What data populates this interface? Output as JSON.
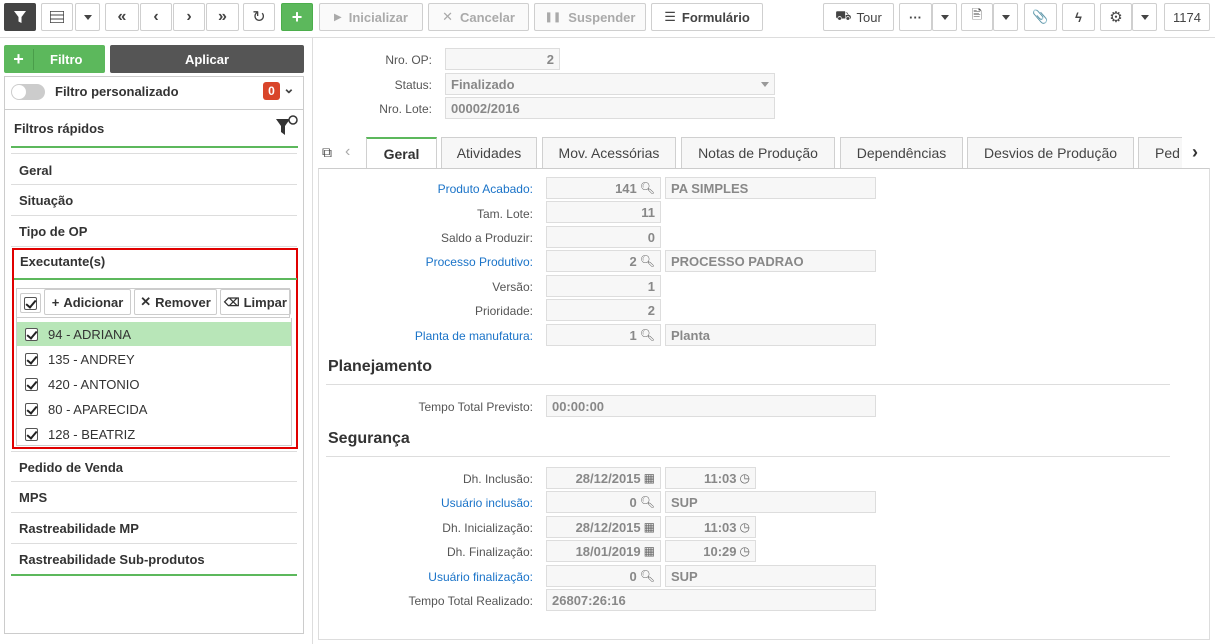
{
  "toolbar": {
    "inicializar": "Inicializar",
    "cancelar": "Cancelar",
    "suspender": "Suspender",
    "formulario": "Formulário",
    "tour": "Tour",
    "counter": "1174"
  },
  "filters": {
    "add_filter": "Filtro",
    "apply": "Aplicar",
    "custom_filter_label": "Filtro personalizado",
    "custom_filter_count": "0",
    "quick_filters_title": "Filtros rápidos",
    "sections_top": [
      "Geral",
      "Situação",
      "Tipo de OP",
      "Executante(s)"
    ],
    "executantes": {
      "add_label": "Adicionar",
      "remove_label": "Remover",
      "clear_label": "Limpar",
      "items": [
        "94 - ADRIANA",
        "135 - ANDREY",
        "420 - ANTONIO",
        "80 - APARECIDA",
        "128 - BEATRIZ"
      ]
    },
    "sections_bottom": [
      "Pedido de Venda",
      "MPS",
      "Rastreabilidade MP",
      "Rastreabilidade Sub-produtos"
    ]
  },
  "header_form": {
    "nro_op_label": "Nro. OP:",
    "nro_op_value": "2",
    "status_label": "Status:",
    "status_value": "Finalizado",
    "nro_lote_label": "Nro. Lote:",
    "nro_lote_value": "00002/2016"
  },
  "tabs": [
    "Geral",
    "Atividades",
    "Mov. Acessórias",
    "Notas de Produção",
    "Dependências",
    "Desvios de Produção",
    "Ped"
  ],
  "geral": {
    "produto_acabado_label": "Produto Acabado:",
    "produto_acabado_code": "141",
    "produto_acabado_desc": "PA SIMPLES",
    "tam_lote_label": "Tam. Lote:",
    "tam_lote_value": "11",
    "saldo_label": "Saldo a Produzir:",
    "saldo_value": "0",
    "processo_label": "Processo Produtivo:",
    "processo_code": "2",
    "processo_desc": "PROCESSO PADRAO",
    "versao_label": "Versão:",
    "versao_value": "1",
    "prioridade_label": "Prioridade:",
    "prioridade_value": "2",
    "planta_label": "Planta de manufatura:",
    "planta_code": "1",
    "planta_desc": "Planta"
  },
  "planejamento": {
    "title": "Planejamento",
    "tempo_label": "Tempo Total Previsto:",
    "tempo_value": "00:00:00"
  },
  "seguranca": {
    "title": "Segurança",
    "dh_inclusao_label": "Dh. Inclusão:",
    "dh_inclusao_date": "28/12/2015",
    "dh_inclusao_time": "11:03",
    "usuario_inclusao_label": "Usuário inclusão:",
    "usuario_inclusao_code": "0",
    "usuario_inclusao_name": "SUP",
    "dh_inicializacao_label": "Dh. Inicialização:",
    "dh_inicializacao_date": "28/12/2015",
    "dh_inicializacao_time": "11:03",
    "dh_finalizacao_label": "Dh. Finalização:",
    "dh_finalizacao_date": "18/01/2019",
    "dh_finalizacao_time": "10:29",
    "usuario_finalizacao_label": "Usuário finalização:",
    "usuario_finalizacao_code": "0",
    "usuario_finalizacao_name": "SUP",
    "tempo_realizado_label": "Tempo Total Realizado:",
    "tempo_realizado_value": "26807:26:16"
  },
  "colors": {
    "accent_green": "#5cb85c",
    "highlight_red": "#e00000",
    "link_blue": "#1a73c8",
    "selected_row": "#b8e6b8"
  }
}
